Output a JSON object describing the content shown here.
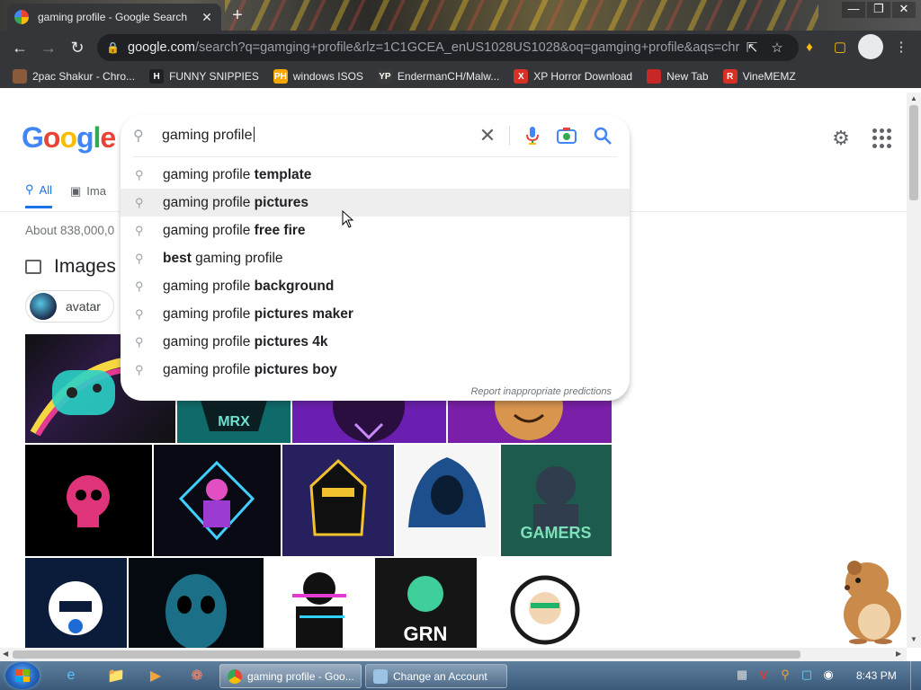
{
  "browser": {
    "tab_title": "gaming profile - Google Search",
    "tab_close": "✕",
    "new_tab": "+",
    "url_host": "google.com",
    "url_rest": "/search?q=gamging+profile&rlz=1C1GCEA_enUS1028US1028&oq=gamging+profile&aqs=chr...",
    "window_controls": [
      "—",
      "❐",
      "✕"
    ]
  },
  "bookmarks": [
    {
      "label": "2pac Shakur - Chro...",
      "icon_text": "",
      "icon_color": "#8a5a3a"
    },
    {
      "label": "FUNNY SNIPPIES",
      "icon_text": "H",
      "icon_color": "#202124"
    },
    {
      "label": "windows ISOS",
      "icon_text": "PH",
      "icon_color": "#f7a600"
    },
    {
      "label": "EndermanCH/Malw...",
      "icon_text": "YP",
      "icon_color": "#3a3a3a"
    },
    {
      "label": "XP Horror Download",
      "icon_text": "X",
      "icon_color": "#d93025"
    },
    {
      "label": "New Tab",
      "icon_text": "",
      "icon_color": "#c62828"
    },
    {
      "label": "VineMEMZ",
      "icon_text": "R",
      "icon_color": "#d93025"
    }
  ],
  "search": {
    "query": "gaming profile",
    "report_label": "Report inappropriate predictions",
    "suggestions": [
      {
        "pre": "gaming profile ",
        "bold": "template",
        "post": ""
      },
      {
        "pre": "gaming profile ",
        "bold": "pictures",
        "post": ""
      },
      {
        "pre": "gaming profile ",
        "bold": "free fire",
        "post": ""
      },
      {
        "pre": "",
        "bold": "best",
        "post": " gaming profile"
      },
      {
        "pre": "gaming profile ",
        "bold": "background",
        "post": ""
      },
      {
        "pre": "gaming profile ",
        "bold": "pictures maker",
        "post": ""
      },
      {
        "pre": "gaming profile ",
        "bold": "pictures 4k",
        "post": ""
      },
      {
        "pre": "gaming profile ",
        "bold": "pictures boy",
        "post": ""
      }
    ]
  },
  "page": {
    "tab_all": "All",
    "tab_images": "Ima",
    "result_stats": "About 838,000,0",
    "images_heading": "Images",
    "chip_label": "avatar"
  },
  "taskbar": {
    "task1": "gaming profile - Goo...",
    "task2": "Change an Account",
    "clock": "8:43 PM"
  },
  "colors": {
    "chrome_dark": "#35363a",
    "omnibox_bg": "#202124",
    "google_blue": "#1a73e8",
    "suggestion_highlight": "#eeeeee"
  }
}
